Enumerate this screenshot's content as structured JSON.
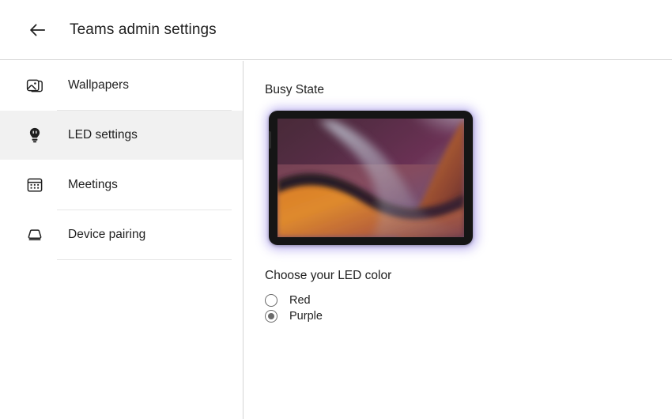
{
  "header": {
    "back_icon": "arrow-left-icon",
    "title": "Teams admin settings"
  },
  "sidebar": {
    "items": [
      {
        "label": "Wallpapers",
        "icon": "images-icon",
        "selected": false
      },
      {
        "label": "LED settings",
        "icon": "lightbulb-icon",
        "selected": true
      },
      {
        "label": "Meetings",
        "icon": "calendar-icon",
        "selected": false
      },
      {
        "label": "Device pairing",
        "icon": "monitor-icon",
        "selected": false
      }
    ]
  },
  "content": {
    "section_title": "Busy State",
    "device_preview": {
      "name": "tablet-preview",
      "glow_color": "#b9aef0",
      "bezel_color": "#151515"
    },
    "chooser": {
      "title": "Choose your LED color",
      "options": [
        {
          "label": "Red",
          "value": "red",
          "selected": false,
          "color": "#e03a3a"
        },
        {
          "label": "Purple",
          "value": "purple",
          "selected": true,
          "color": "#8a6fe0"
        }
      ]
    }
  },
  "colors": {
    "divider": "#d6d6d6",
    "selected_row_bg": "#f1f1f1",
    "text": "#1f1f1f",
    "radio_stroke": "#6b6b6b"
  }
}
